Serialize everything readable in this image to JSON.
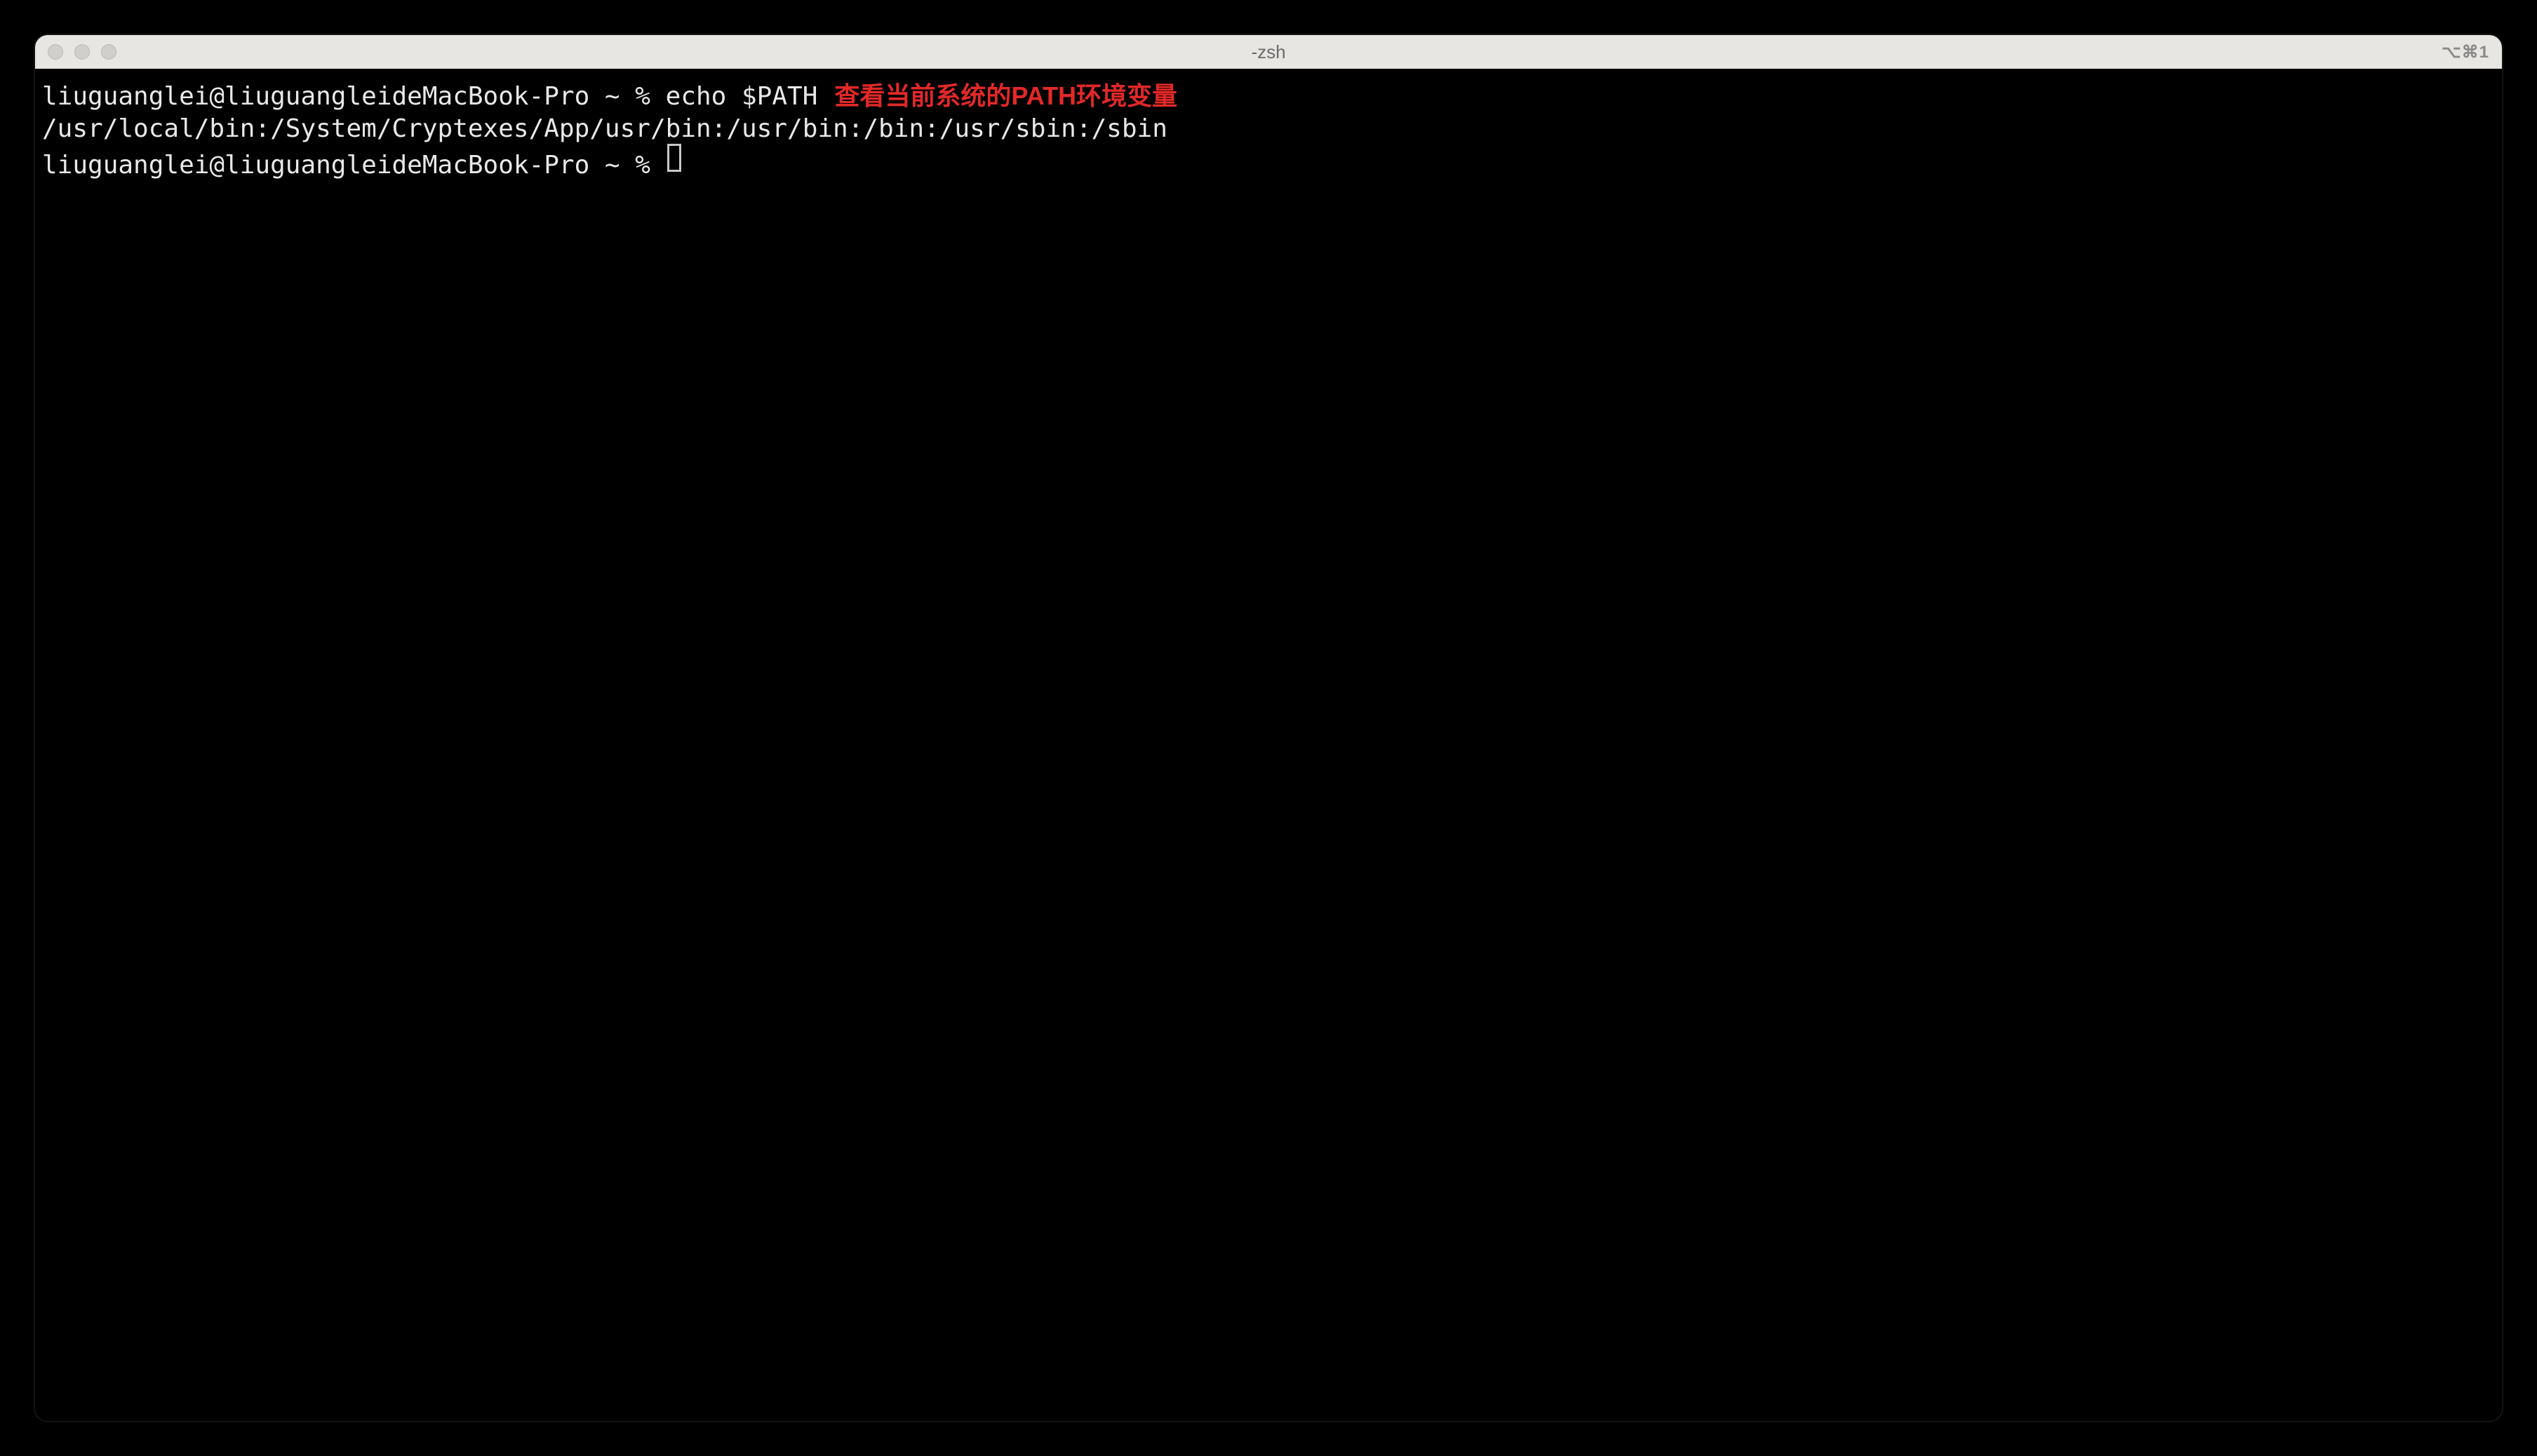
{
  "window": {
    "title": "-zsh",
    "shortcut": "⌥⌘1"
  },
  "terminal": {
    "lines": [
      {
        "prompt": "liuguanglei@liuguangleideMacBook-Pro ~ % ",
        "command": "echo $PATH",
        "annotation": "查看当前系统的PATH环境变量"
      }
    ],
    "output": "/usr/local/bin:/System/Cryptexes/App/usr/bin:/usr/bin:/bin:/usr/sbin:/sbin",
    "current_prompt": "liuguanglei@liuguangleideMacBook-Pro ~ % "
  },
  "colors": {
    "annotation": "#e22828",
    "text": "#e8e8e8",
    "titlebar_bg": "#e8e6e3",
    "terminal_bg": "#000000"
  }
}
